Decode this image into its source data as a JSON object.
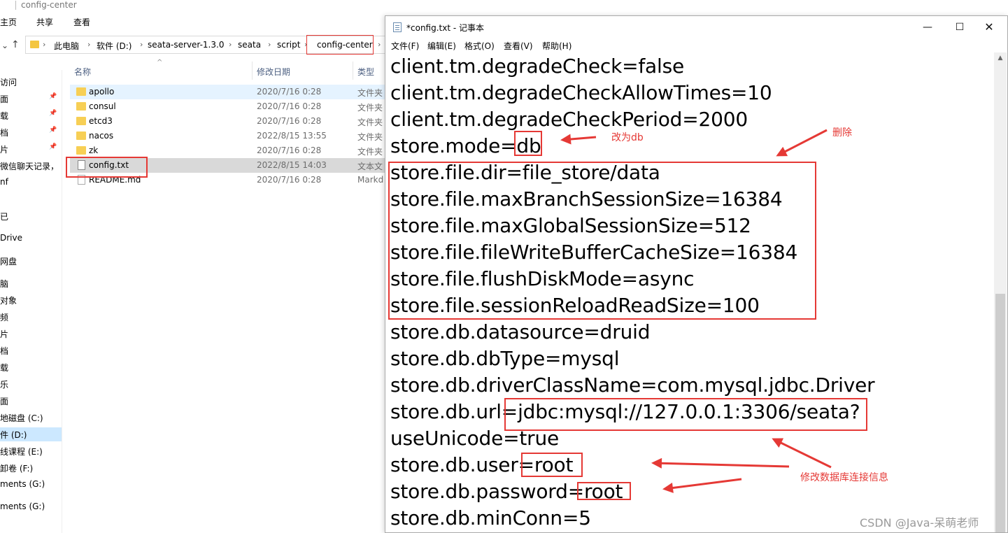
{
  "explorer": {
    "title": "config-center",
    "ribbon": [
      "主页",
      "共享",
      "查看"
    ],
    "breadcrumb": [
      "此电脑",
      "软件 (D:)",
      "seata-server-1.3.0",
      "seata",
      "script",
      "config-center"
    ],
    "columns": {
      "name": "名称",
      "date": "修改日期",
      "type": "类型"
    },
    "sidebar": [
      {
        "label": "访问",
        "pinned": false
      },
      {
        "label": "面",
        "pinned": true
      },
      {
        "label": "载",
        "pinned": true
      },
      {
        "label": "档",
        "pinned": true
      },
      {
        "label": "片",
        "pinned": true
      },
      {
        "label": "微信聊天记录，",
        "pinned": false
      },
      {
        "label": "nf",
        "pinned": false
      },
      {
        "label": "已",
        "pinned": false
      },
      {
        "label": "Drive",
        "pinned": false
      },
      {
        "label": "网盘",
        "pinned": false
      },
      {
        "label": "脑",
        "pinned": false
      },
      {
        "label": "对象",
        "pinned": false
      },
      {
        "label": "频",
        "pinned": false
      },
      {
        "label": "片",
        "pinned": false
      },
      {
        "label": "档",
        "pinned": false
      },
      {
        "label": "载",
        "pinned": false
      },
      {
        "label": "乐",
        "pinned": false
      },
      {
        "label": "面",
        "pinned": false
      },
      {
        "label": "地磁盘 (C:)",
        "pinned": false
      },
      {
        "label": "件 (D:)",
        "pinned": false
      },
      {
        "label": "线课程 (E:)",
        "pinned": false
      },
      {
        "label": "卸卷 (F:)",
        "pinned": false
      },
      {
        "label": "ments (G:)",
        "pinned": false
      },
      {
        "label": "ments (G:)",
        "pinned": false
      }
    ],
    "files": [
      {
        "name": "apollo",
        "date": "2020/7/16 0:28",
        "type": "文件夹",
        "kind": "folder"
      },
      {
        "name": "consul",
        "date": "2020/7/16 0:28",
        "type": "文件夹",
        "kind": "folder"
      },
      {
        "name": "etcd3",
        "date": "2020/7/16 0:28",
        "type": "文件夹",
        "kind": "folder"
      },
      {
        "name": "nacos",
        "date": "2022/8/15 13:55",
        "type": "文件夹",
        "kind": "folder"
      },
      {
        "name": "zk",
        "date": "2020/7/16 0:28",
        "type": "文件夹",
        "kind": "folder"
      },
      {
        "name": "config.txt",
        "date": "2022/8/15 14:03",
        "type": "文本文",
        "kind": "txt"
      },
      {
        "name": "README.md",
        "date": "2020/7/16 0:28",
        "type": "Markd",
        "kind": "md"
      }
    ]
  },
  "notepad": {
    "title": "*config.txt - 记事本",
    "menu": [
      "文件(F)",
      "编辑(E)",
      "格式(O)",
      "查看(V)",
      "帮助(H)"
    ],
    "lines": [
      "client.tm.degradeCheck=false",
      "client.tm.degradeCheckAllowTimes=10",
      "client.tm.degradeCheckPeriod=2000",
      "store.mode=db",
      "store.file.dir=file_store/data",
      "store.file.maxBranchSessionSize=16384",
      "store.file.maxGlobalSessionSize=512",
      "store.file.fileWriteBufferCacheSize=16384",
      "store.file.flushDiskMode=async",
      "store.file.sessionReloadReadSize=100",
      "store.db.datasource=druid",
      "store.db.dbType=mysql",
      "store.db.driverClassName=com.mysql.jdbc.Driver",
      "store.db.url=jdbc:mysql://127.0.0.1:3306/seata?",
      "useUnicode=true",
      "store.db.user=root",
      "store.db.password=root",
      "store.db.minConn=5"
    ]
  },
  "annotations": {
    "change_to_db": "改为db",
    "delete": "删除",
    "modify_db_info": "修改数据库连接信息",
    "color": "#e53935"
  },
  "watermark": "CSDN @Java-呆萌老师"
}
